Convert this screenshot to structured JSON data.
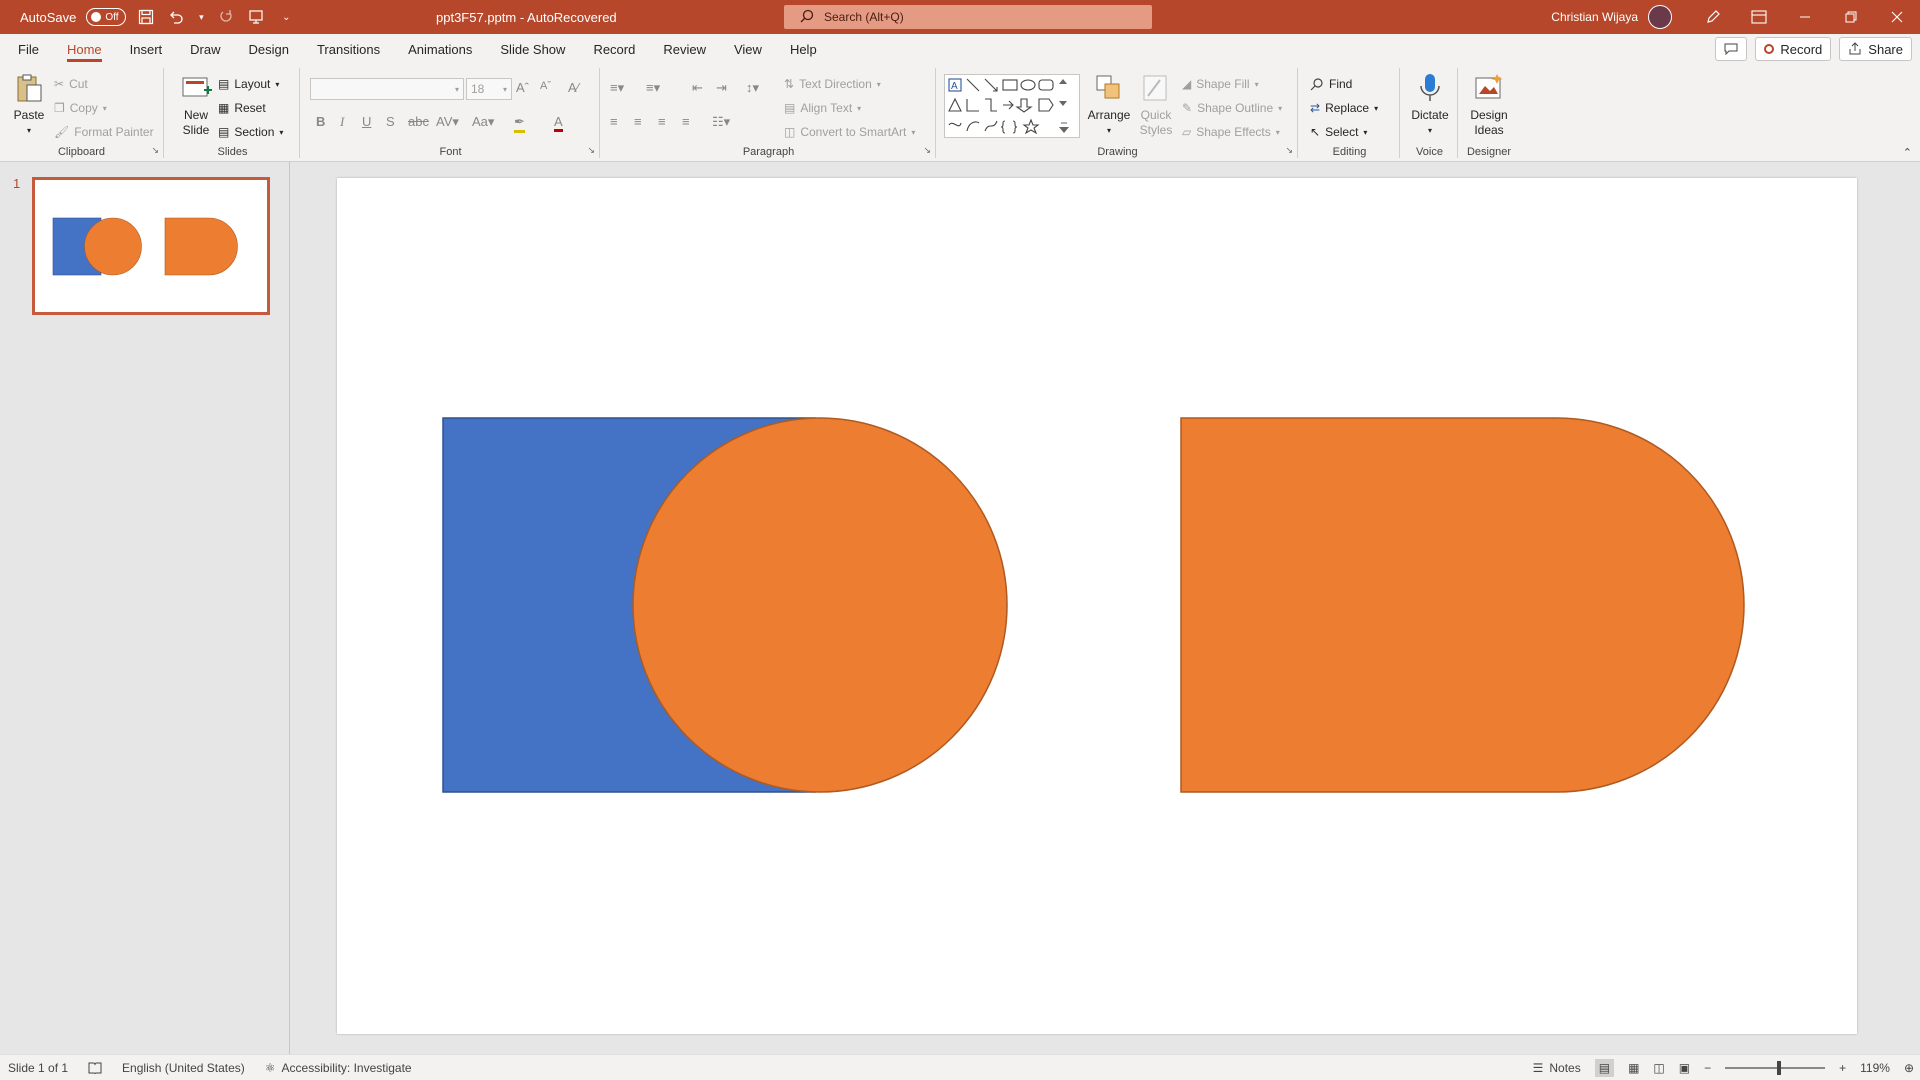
{
  "titlebar": {
    "autosave_label": "AutoSave",
    "autosave_state": "Off",
    "document_title": "ppt3F57.pptm - AutoRecovered",
    "search_placeholder": "Search (Alt+Q)",
    "username": "Christian Wijaya"
  },
  "tabs": [
    "File",
    "Home",
    "Insert",
    "Draw",
    "Design",
    "Transitions",
    "Animations",
    "Slide Show",
    "Record",
    "Review",
    "View",
    "Help"
  ],
  "active_tab": "Home",
  "menu_right": {
    "record_label": "Record",
    "share_label": "Share"
  },
  "ribbon": {
    "clipboard": {
      "label": "Clipboard",
      "paste": "Paste",
      "cut": "Cut",
      "copy": "Copy",
      "format_painter": "Format Painter"
    },
    "slides": {
      "label": "Slides",
      "new_slide_line1": "New",
      "new_slide_line2": "Slide",
      "layout": "Layout",
      "reset": "Reset",
      "section": "Section"
    },
    "font": {
      "label": "Font",
      "font_name": "",
      "font_size": "18"
    },
    "paragraph": {
      "label": "Paragraph",
      "text_direction": "Text Direction",
      "align_text": "Align Text",
      "convert_smartart": "Convert to SmartArt"
    },
    "drawing": {
      "label": "Drawing",
      "arrange": "Arrange",
      "quick_styles_line1": "Quick",
      "quick_styles_line2": "Styles",
      "shape_fill": "Shape Fill",
      "shape_outline": "Shape Outline",
      "shape_effects": "Shape Effects"
    },
    "editing": {
      "label": "Editing",
      "find": "Find",
      "replace": "Replace",
      "select": "Select"
    },
    "voice": {
      "label": "Voice",
      "dictate": "Dictate"
    },
    "designer": {
      "label": "Designer",
      "design_ideas_line1": "Design",
      "design_ideas_line2": "Ideas"
    }
  },
  "thumbnails": [
    {
      "number": "1"
    }
  ],
  "colors": {
    "accent": "#b7472a",
    "shape_blue": "#4472c4",
    "shape_orange": "#ed7d31",
    "shape_outline_blue": "#2f528f",
    "shape_outline_orange": "#ae5a21"
  },
  "statusbar": {
    "slide_info": "Slide 1 of 1",
    "language": "English (United States)",
    "accessibility": "Accessibility: Investigate",
    "notes": "Notes",
    "zoom": "119%"
  }
}
